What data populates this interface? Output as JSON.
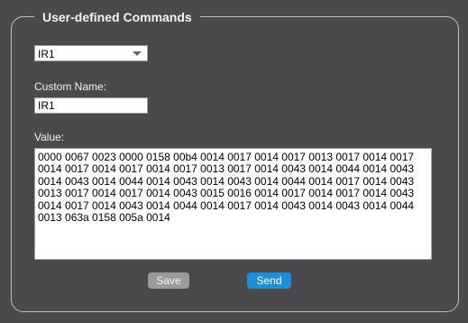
{
  "section": {
    "title": "User-defined Commands"
  },
  "command_select": {
    "selected": "IR1"
  },
  "custom_name": {
    "label": "Custom Name:",
    "value": "IR1"
  },
  "value": {
    "label": "Value:",
    "text": "0000 0067 0023 0000 0158 00b4 0014 0017 0014 0017 0013 0017 0014 0017 0014 0017 0014 0017 0014 0017 0013 0017 0014 0043 0014 0044 0014 0043 0014 0043 0014 0044 0014 0043 0014 0043 0014 0044 0014 0017 0014 0043 0013 0017 0014 0017 0014 0043 0015 0016 0014 0017 0014 0017 0014 0043 0014 0017 0014 0043 0014 0044 0014 0017 0014 0043 0014 0043 0014 0044 0013 063a 0158 005a 0014"
  },
  "buttons": {
    "save_label": "Save",
    "send_label": "Send"
  },
  "colors": {
    "panel_bg": "#4a4a4d",
    "save_bg": "#9b9b9b",
    "send_bg": "#1d8fd8"
  }
}
